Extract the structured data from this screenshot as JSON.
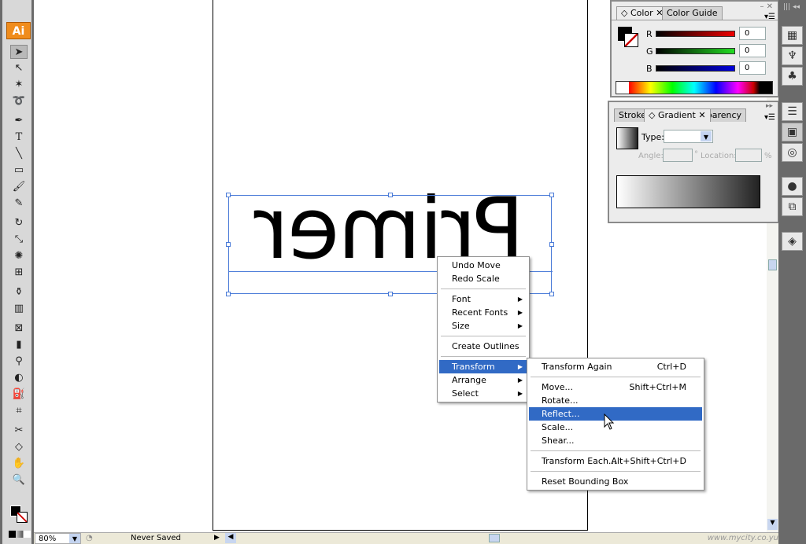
{
  "app": {
    "logo": "Ai"
  },
  "tools": [
    "selection",
    "direct-selection",
    "magic-wand",
    "lasso",
    "pen",
    "type",
    "line",
    "rectangle",
    "paintbrush",
    "pencil",
    "rotate",
    "scale",
    "warp",
    "free-transform",
    "symbol-sprayer",
    "column-graph",
    "mesh",
    "gradient",
    "eyedropper",
    "blend",
    "live-paint",
    "slice",
    "scissors",
    "hand",
    "zoom"
  ],
  "canvas": {
    "text": "Primer"
  },
  "color_panel": {
    "tabs": [
      "Color",
      "Color Guide"
    ],
    "r_label": "R",
    "g_label": "G",
    "b_label": "B",
    "r": "0",
    "g": "0",
    "b": "0",
    "fill": "#000000"
  },
  "gradient_panel": {
    "tabs": [
      "Stroke",
      "Gradient",
      "sparency"
    ],
    "type_label": "Type:",
    "type_value": "",
    "angle_label": "Angle:",
    "degree": "°",
    "location_label": "Location:",
    "percent": "%"
  },
  "context_menu": {
    "items": [
      {
        "label": "Undo Move"
      },
      {
        "label": "Redo Scale"
      },
      {
        "label": "Font",
        "submenu": true
      },
      {
        "label": "Recent Fonts",
        "submenu": true
      },
      {
        "label": "Size",
        "submenu": true
      },
      {
        "label": "Create Outlines"
      },
      {
        "label": "Transform",
        "submenu": true,
        "highlighted": true
      },
      {
        "label": "Arrange",
        "submenu": true
      },
      {
        "label": "Select",
        "submenu": true
      }
    ]
  },
  "transform_menu": {
    "items": [
      {
        "label": "Transform Again",
        "shortcut": "Ctrl+D"
      },
      {
        "label": "Move...",
        "shortcut": "Shift+Ctrl+M"
      },
      {
        "label": "Rotate...",
        "shortcut": ""
      },
      {
        "label": "Reflect...",
        "shortcut": "",
        "highlighted": true
      },
      {
        "label": "Scale...",
        "shortcut": ""
      },
      {
        "label": "Shear...",
        "shortcut": ""
      },
      {
        "label": "Transform Each...",
        "shortcut": "Alt+Shift+Ctrl+D"
      },
      {
        "label": "Reset Bounding Box",
        "shortcut": ""
      }
    ]
  },
  "status": {
    "zoom": "80%",
    "doc_status": "Never Saved"
  },
  "watermark": "www.mycity.co.yu"
}
